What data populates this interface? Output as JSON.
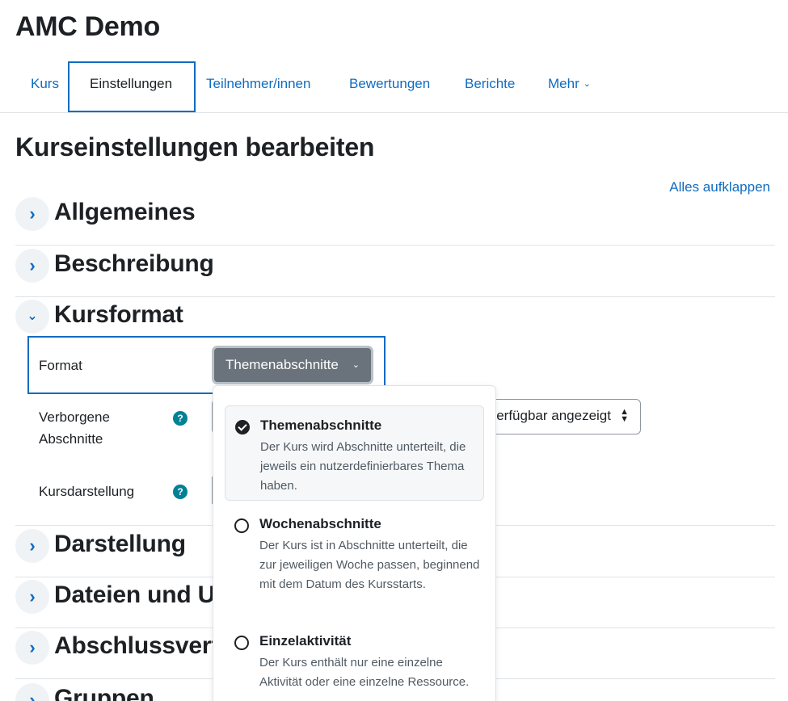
{
  "course_title": "AMC Demo",
  "nav": {
    "items": [
      {
        "label": "Kurs"
      },
      {
        "label": "Einstellungen"
      },
      {
        "label": "Teilnehmer/innen"
      },
      {
        "label": "Bewertungen"
      },
      {
        "label": "Berichte"
      },
      {
        "label": "Mehr"
      }
    ],
    "more_icon": "chevron-down-icon"
  },
  "page_title": "Kurseinstellungen bearbeiten",
  "expand_all": "Alles aufklappen",
  "sections": [
    {
      "title": "Allgemeines",
      "expanded": false
    },
    {
      "title": "Beschreibung",
      "expanded": false
    },
    {
      "title": "Kursformat",
      "expanded": true
    },
    {
      "title": "Darstellung",
      "expanded": false
    },
    {
      "title": "Dateien und U",
      "expanded": false
    },
    {
      "title": "Abschlussvert",
      "expanded": false
    },
    {
      "title": "Gruppen",
      "expanded": false
    }
  ],
  "kursformat": {
    "format_label": "Format",
    "format_value": "Themenabschnitte",
    "hidden_label": "Verborgene Abschnitte",
    "hidden_value": "erfügbar angezeigt",
    "layout_label": "Kursdarstellung",
    "help_icon": "?"
  },
  "dropdown": {
    "options": [
      {
        "title": "Themenabschnitte",
        "desc": "Der Kurs wird Abschnitte unterteilt, die jeweils ein nutzerdefinierbares Thema haben.",
        "selected": true
      },
      {
        "title": "Wochenabschnitte",
        "desc": "Der Kurs ist in Abschnitte unterteilt, die zur jeweiligen Woche passen, beginnend mit dem Datum des Kursstarts.",
        "selected": false
      },
      {
        "title": "Einzelaktivität",
        "desc": "Der Kurs enthält nur eine einzelne Aktivität oder eine einzelne Ressource.",
        "selected": false
      }
    ]
  },
  "colors": {
    "link": "#0f6cbf",
    "focus": "#0f6cbf",
    "help": "#008196",
    "select_active": "#6a737b"
  }
}
